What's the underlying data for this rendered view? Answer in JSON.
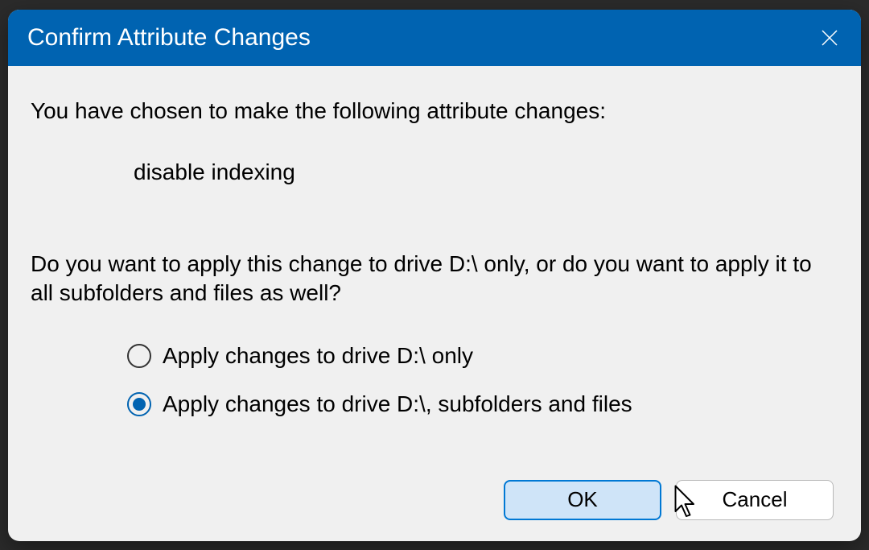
{
  "dialog": {
    "title": "Confirm Attribute Changes",
    "prompt1": "You have chosen to make the following attribute changes:",
    "attribute_change": "disable indexing",
    "prompt2": "Do you want to apply this change to drive D:\\ only, or do you want to apply it to all subfolders and files as well?",
    "options": {
      "opt1": "Apply changes to drive D:\\ only",
      "opt2": "Apply changes to drive D:\\, subfolders and files"
    },
    "selected_option": "opt2",
    "buttons": {
      "ok": "OK",
      "cancel": "Cancel"
    }
  }
}
